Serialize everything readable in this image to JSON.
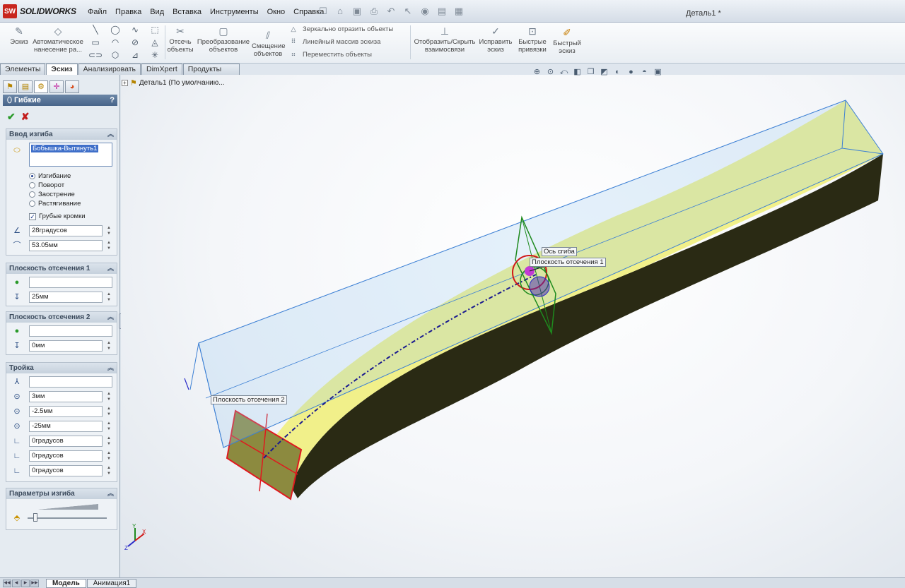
{
  "app": {
    "name": "SOLIDWORKS",
    "logo_badge": "SW",
    "document_title": "Деталь1 *"
  },
  "menu": [
    "Файл",
    "Правка",
    "Вид",
    "Вставка",
    "Инструменты",
    "Окно",
    "Справка"
  ],
  "ribbon": {
    "sketch": "Эскиз",
    "auto_dim": "Автоматическое нанесение ра...",
    "trim": "Отсечь объекты",
    "convert": "Преобразование объектов",
    "offset": "Смещение объектов",
    "mirror": "Зеркально отразить объекты",
    "linear_pattern": "Линейный массив эскиза",
    "move": "Переместить объекты",
    "show_relations": "Отобразить/Скрыть взаимосвязи",
    "repair": "Исправить эскиз",
    "quick_snaps": "Быстрые привязки",
    "rapid_sketch": "Быстрый эскиз"
  },
  "tabs": [
    "Элементы",
    "Эскиз",
    "Анализировать",
    "DimXpert",
    "Продукты Office"
  ],
  "active_tab": "Эскиз",
  "feature_tree": {
    "root": "Деталь1  (По умолчанию..."
  },
  "property_manager": {
    "title": "Гибкие",
    "help": "?",
    "bend_input": {
      "header": "Ввод изгиба",
      "selected_body": "Бобышка-Вытянуть1",
      "options": [
        "Изгибание",
        "Поворот",
        "Заострение",
        "Растягивание"
      ],
      "selected_option": "Изгибание",
      "rough_edges_label": "Грубые кромки",
      "rough_edges_checked": true,
      "angle": "28градусов",
      "radius": "53.05мм"
    },
    "trim_plane_1": {
      "header": "Плоскость отсечения 1",
      "reference": "",
      "distance": "25мм"
    },
    "trim_plane_2": {
      "header": "Плоскость отсечения 2",
      "reference": "",
      "distance": "0мм"
    },
    "triad": {
      "header": "Тройка",
      "reference": "",
      "x": "3мм",
      "y": "-2.5мм",
      "z": "-25мм",
      "rot_x": "0градусов",
      "rot_y": "0градусов",
      "rot_z": "0градусов"
    },
    "bend_params": {
      "header": "Параметры изгиба",
      "accuracy": 0.1
    }
  },
  "viewport": {
    "callouts": {
      "bend_axis": "Ось сгиба",
      "trim_plane_1": "Плоскость отсечения 1",
      "trim_plane_2": "Плоскость отсечения 2"
    },
    "colors": {
      "top_face": "#f1f08a",
      "side_face": "#2a2a14",
      "wire": "#3b7fd4",
      "end_face": "#8c8a3f",
      "trim_plane_1": "#1e8a1e",
      "trim_plane_2": "#e0181f",
      "bend_axis": "#1a1a8f"
    },
    "triad_labels": {
      "x": "X",
      "y": "Y",
      "z": "Z"
    }
  },
  "bottom_tabs": [
    "Модель",
    "Анимация1"
  ],
  "active_bottom_tab": "Модель"
}
